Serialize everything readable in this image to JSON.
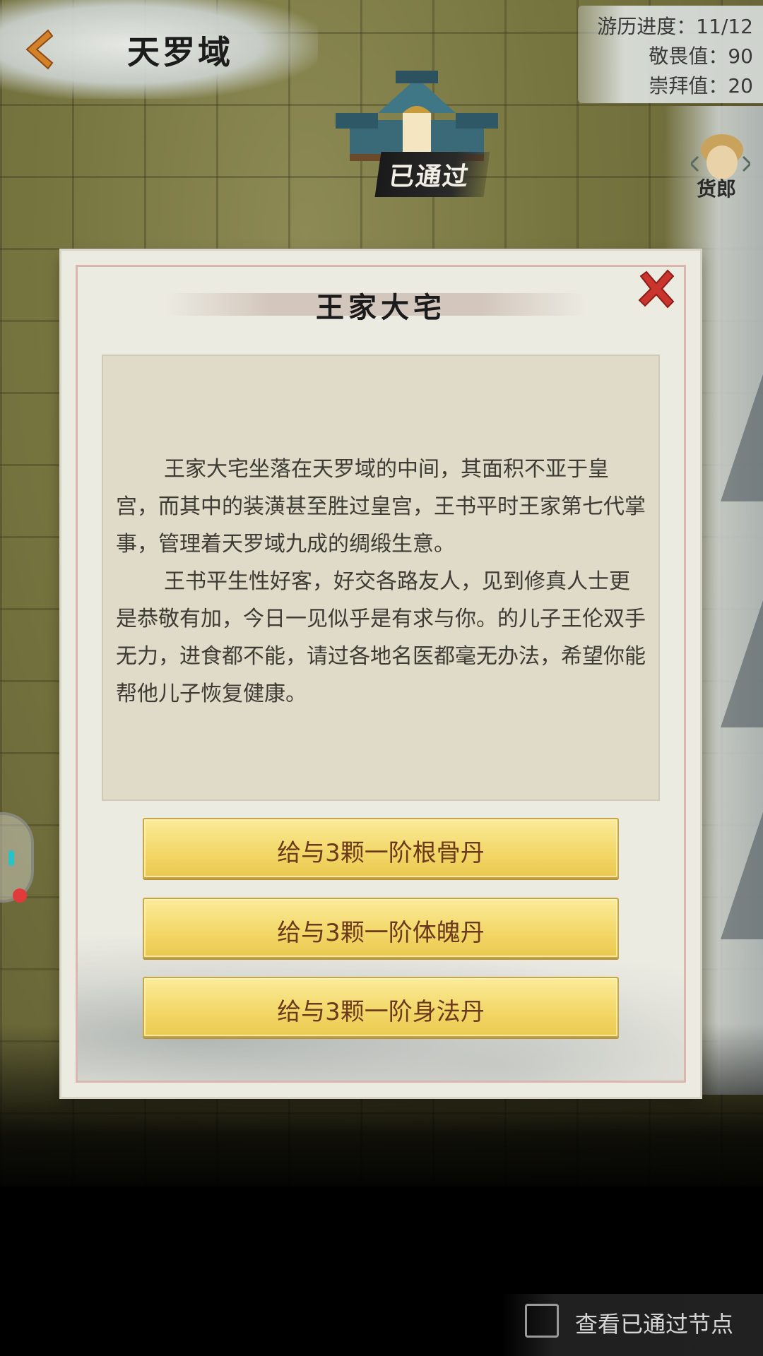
{
  "header": {
    "region_name": "天罗域"
  },
  "stats": {
    "progress": "游历进度：11/12",
    "reverence": "敬畏值：90",
    "worship": "崇拜值：20"
  },
  "map": {
    "node_badge": "已通过",
    "merchant_label": "货郎"
  },
  "dialog": {
    "title": "王家大宅",
    "paragraphs": [
      "王家大宅坐落在天罗域的中间，其面积不亚于皇宫，而其中的装潢甚至胜过皇宫，王书平时王家第七代掌事，管理着天罗域九成的绸缎生意。",
      "王书平生性好客，好交各路友人，见到修真人士更是恭敬有加，今日一见似乎是有求与你。的儿子王伦双手无力，进食都不能，请过各地名医都毫无办法，希望你能帮他儿子恢复健康。"
    ],
    "choices": [
      "给与3颗一阶根骨丹",
      "给与3颗一阶体魄丹",
      "给与3颗一阶身法丹"
    ]
  },
  "footer": {
    "checkbox_label": "查看已通过节点",
    "checked": false
  },
  "colors": {
    "button_gold": "#f3d86a",
    "button_text": "#6b3a1d",
    "close_red": "#c9342c",
    "back_orange": "#d4822a"
  },
  "icons": {
    "back": "back-arrow-icon",
    "close": "close-x-icon",
    "building": "palace-building-icon",
    "merchant": "merchant-avatar-icon"
  }
}
